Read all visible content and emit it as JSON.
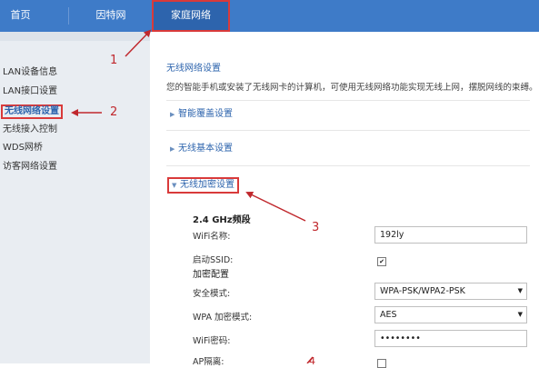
{
  "nav": {
    "tabs": [
      {
        "label": "首页"
      },
      {
        "label": "因特网"
      },
      {
        "label": "家庭网络"
      }
    ]
  },
  "sidebar": {
    "items": [
      {
        "label": "LAN设备信息"
      },
      {
        "label": "LAN接口设置"
      },
      {
        "label": "无线网络设置"
      },
      {
        "label": "无线接入控制"
      },
      {
        "label": "WDS网桥"
      },
      {
        "label": "访客网络设置"
      }
    ]
  },
  "main": {
    "title": "无线网络设置",
    "description": "您的智能手机或安装了无线网卡的计算机，可使用无线网络功能实现无线上网，摆脱网线的束缚。",
    "sections": {
      "coverage": "智能覆盖设置",
      "basic": "无线基本设置",
      "encryption": "无线加密设置"
    },
    "band_title": "2.4 GHz频段",
    "form": {
      "wifi_name_label": "WiFi名称:",
      "wifi_name_value": "192ly",
      "ssid_label": "启动SSID:",
      "ssid_checked": true,
      "encrypt_config_label": "加密配置",
      "security_mode_label": "安全模式:",
      "security_mode_value": "WPA-PSK/WPA2-PSK",
      "wpa_mode_label": "WPA 加密模式:",
      "wpa_mode_value": "AES",
      "password_label": "WiFi密码:",
      "password_value": "••••••••",
      "ap_isolation_label": "AP隔离:",
      "ap_isolation_checked": false
    }
  },
  "annotations": {
    "numbers": [
      "1",
      "2",
      "3",
      "4"
    ],
    "color": "#c0282d"
  },
  "colors": {
    "nav_bg": "#3e7bc8",
    "nav_active": "#2d64ad",
    "highlight_border": "#d93a3a",
    "sidebar_bg": "#e9edf2",
    "link_blue": "#2d64ad"
  }
}
